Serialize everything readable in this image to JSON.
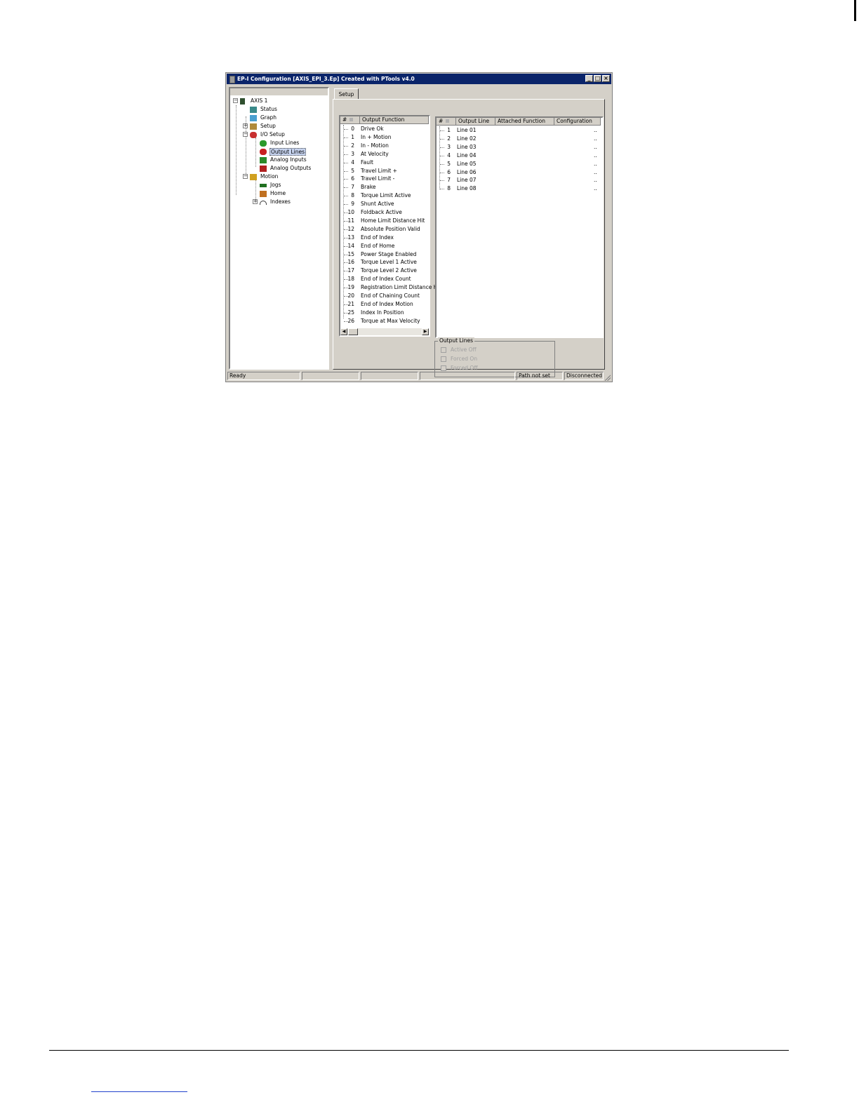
{
  "window": {
    "title": "EP-I Configuration  [AXIS_EPI_3.Ep] Created with PTools v4.0",
    "min": "_",
    "max": "□",
    "close": "×"
  },
  "tree": {
    "root": "AXIS 1",
    "items": [
      "Status",
      "Graph",
      "Setup",
      "I/O Setup",
      "Input Lines",
      "Output Lines",
      "Analog Inputs",
      "Analog Outputs",
      "Motion",
      "Jogs",
      "Home",
      "Indexes"
    ],
    "selected": "Output Lines"
  },
  "tab": {
    "label": "Setup"
  },
  "output_functions": {
    "headers": [
      "#",
      "Output Function"
    ],
    "rows": [
      {
        "num": "0",
        "name": "Drive Ok"
      },
      {
        "num": "1",
        "name": "In + Motion"
      },
      {
        "num": "2",
        "name": "In - Motion"
      },
      {
        "num": "3",
        "name": "At Velocity"
      },
      {
        "num": "4",
        "name": "Fault"
      },
      {
        "num": "5",
        "name": "Travel Limit +"
      },
      {
        "num": "6",
        "name": "Travel Limit -"
      },
      {
        "num": "7",
        "name": "Brake"
      },
      {
        "num": "8",
        "name": "Torque Limit Active"
      },
      {
        "num": "9",
        "name": "Shunt Active"
      },
      {
        "num": "10",
        "name": "Foldback Active"
      },
      {
        "num": "11",
        "name": "Home Limit Distance Hit"
      },
      {
        "num": "12",
        "name": "Absolute Position Valid"
      },
      {
        "num": "13",
        "name": "End of Index"
      },
      {
        "num": "14",
        "name": "End of Home"
      },
      {
        "num": "15",
        "name": "Power Stage Enabled"
      },
      {
        "num": "16",
        "name": "Torque Level 1 Active"
      },
      {
        "num": "17",
        "name": "Torque Level 2 Active"
      },
      {
        "num": "18",
        "name": "End of Index Count"
      },
      {
        "num": "19",
        "name": "Registration Limit Distance Hit"
      },
      {
        "num": "20",
        "name": "End of Chaining Count"
      },
      {
        "num": "21",
        "name": "End of Index Motion"
      },
      {
        "num": "25",
        "name": "Index In Position"
      },
      {
        "num": "26",
        "name": "Torque at Max Velocity"
      }
    ]
  },
  "output_lines": {
    "headers": [
      "#",
      "Output Line",
      "Attached Function",
      "Configuration"
    ],
    "rows": [
      {
        "num": "1",
        "line": "Line 01",
        "func": "",
        "config": ".."
      },
      {
        "num": "2",
        "line": "Line 02",
        "func": "",
        "config": ".."
      },
      {
        "num": "3",
        "line": "Line 03",
        "func": "",
        "config": ".."
      },
      {
        "num": "4",
        "line": "Line 04",
        "func": "",
        "config": ".."
      },
      {
        "num": "5",
        "line": "Line 05",
        "func": "",
        "config": ".."
      },
      {
        "num": "6",
        "line": "Line 06",
        "func": "",
        "config": ".."
      },
      {
        "num": "7",
        "line": "Line 07",
        "func": "",
        "config": ".."
      },
      {
        "num": "8",
        "line": "Line 08",
        "func": "",
        "config": ".."
      }
    ]
  },
  "output_group": {
    "title": "Output Lines",
    "options": [
      "Active Off",
      "Forced On",
      "Forced Off"
    ]
  },
  "status": {
    "ready": "Ready",
    "path": "Path not set",
    "connection": "Disconnected"
  }
}
